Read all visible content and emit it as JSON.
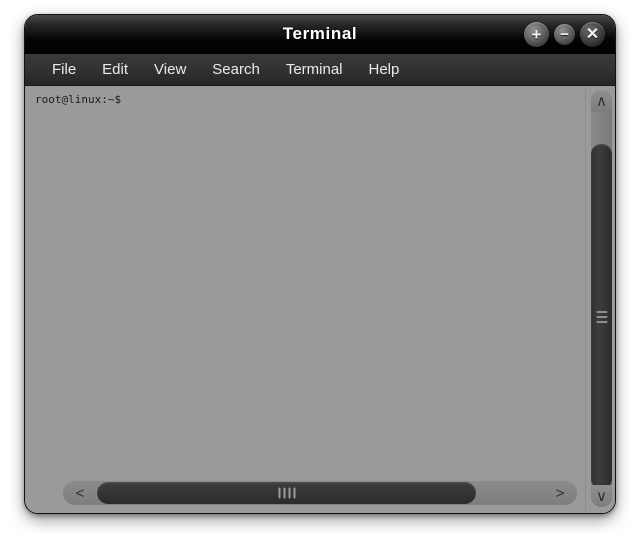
{
  "window": {
    "title": "Terminal",
    "controls": [
      {
        "name": "maximize",
        "glyph": "+"
      },
      {
        "name": "minimize",
        "glyph": "−"
      },
      {
        "name": "close",
        "glyph": "✕"
      }
    ]
  },
  "menubar": {
    "items": [
      {
        "label": "File"
      },
      {
        "label": "Edit"
      },
      {
        "label": "View"
      },
      {
        "label": "Search"
      },
      {
        "label": "Terminal"
      },
      {
        "label": "Help"
      }
    ]
  },
  "terminal": {
    "prompt": "root@linux:~$",
    "background_color": "#9a9a9a",
    "text_color": "#1c1c1c"
  },
  "scrollbars": {
    "vertical": {
      "up_arrow": "∧",
      "down_arrow": "∨"
    },
    "horizontal": {
      "left_arrow": "<",
      "right_arrow": ">"
    }
  }
}
